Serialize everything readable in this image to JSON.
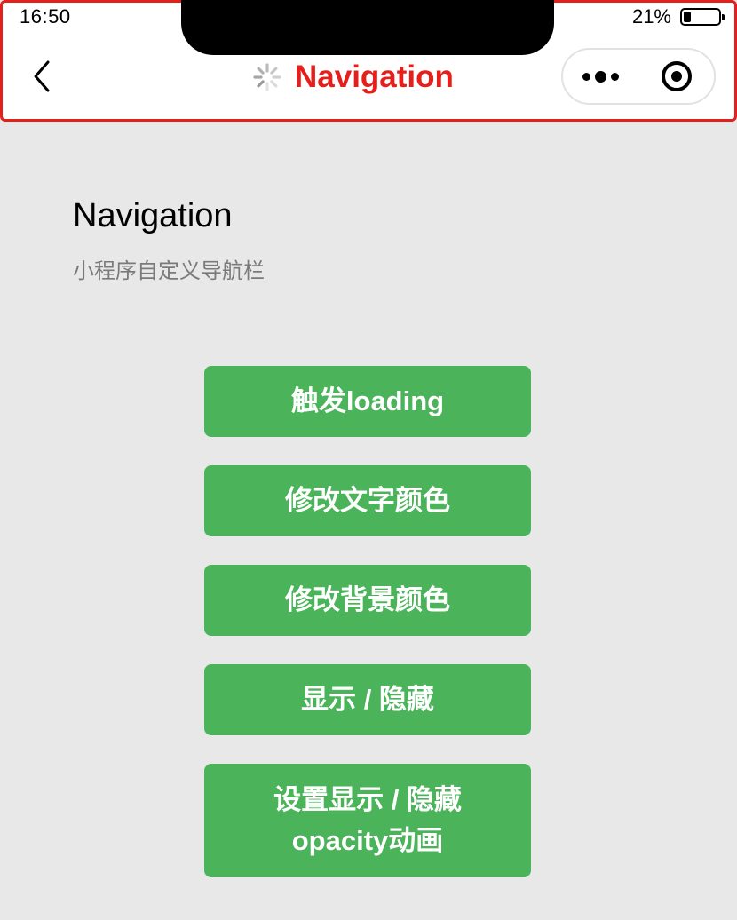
{
  "status_bar": {
    "time": "16:50",
    "battery_percent": "21%",
    "battery_level": 0.21
  },
  "navbar": {
    "title": "Navigation",
    "title_color": "#e5201c",
    "back_icon": "chevron-left-icon",
    "loading_icon": "spinner-icon",
    "capsule": {
      "more_icon": "more-dots-icon",
      "close_icon": "target-icon"
    }
  },
  "page": {
    "title": "Navigation",
    "description": "小程序自定义导航栏"
  },
  "buttons": [
    {
      "label": "触发loading"
    },
    {
      "label": "修改文字颜色"
    },
    {
      "label": "修改背景颜色"
    },
    {
      "label": "显示 / 隐藏"
    },
    {
      "label_line1": "设置显示 / 隐藏",
      "label_line2": "opacity动画"
    }
  ],
  "colors": {
    "button_bg": "#4bb35a",
    "page_bg": "#e8e8e8",
    "highlight_border": "#e5201c"
  }
}
